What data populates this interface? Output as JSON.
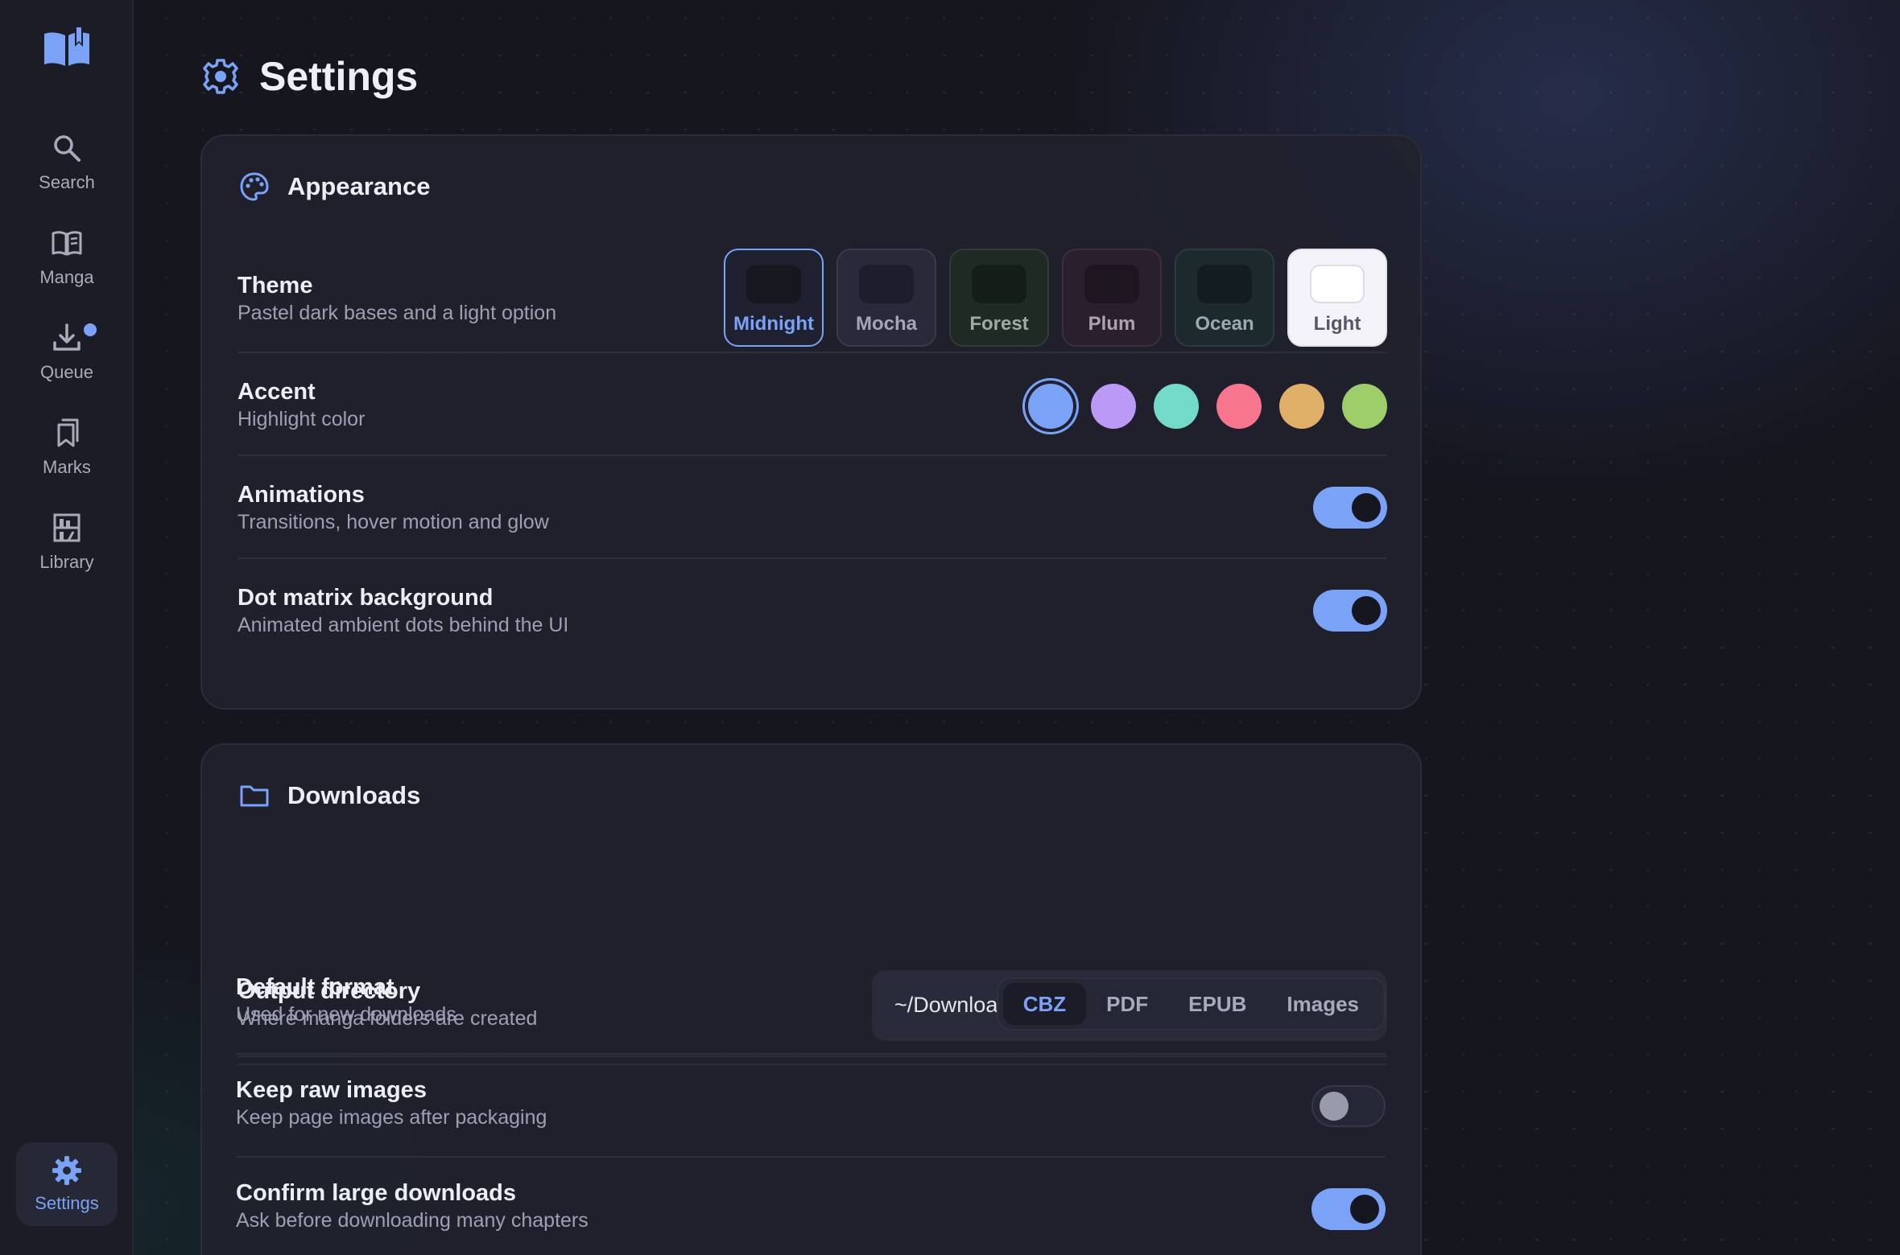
{
  "sidebar": {
    "items": [
      {
        "label": "Search",
        "icon": "search-icon"
      },
      {
        "label": "Manga",
        "icon": "book-open-icon"
      },
      {
        "label": "Queue",
        "icon": "download-icon",
        "badge": true
      },
      {
        "label": "Marks",
        "icon": "bookmarks-icon"
      },
      {
        "label": "Library",
        "icon": "bookshelf-icon"
      }
    ],
    "settings_label": "Settings"
  },
  "header": {
    "title": "Settings"
  },
  "appearance": {
    "title": "Appearance",
    "theme": {
      "title": "Theme",
      "sub": "Pastel dark bases and a light option",
      "options": [
        {
          "label": "Midnight",
          "bg": "#1f2030",
          "inner": "#16171f",
          "text": "#7aa2f7",
          "border": "#7aa2f7"
        },
        {
          "label": "Mocha",
          "bg": "#2a2939",
          "inner": "#1e1d2b",
          "text": "#a4a5b8",
          "border": "#3a3a4f"
        },
        {
          "label": "Forest",
          "bg": "#1f2a24",
          "inner": "#151d19",
          "text": "#9eaaa3",
          "border": "#2f3d34"
        },
        {
          "label": "Plum",
          "bg": "#2a1f2d",
          "inner": "#1d1520",
          "text": "#aea2b2",
          "border": "#3c2e40"
        },
        {
          "label": "Ocean",
          "bg": "#1c2a2e",
          "inner": "#131d21",
          "text": "#9aaaae",
          "border": "#2b3c41"
        },
        {
          "label": "Light",
          "bg": "#f4f4f8",
          "inner": "#ffffff",
          "text": "#55566a",
          "border": "#e2e2ea"
        }
      ],
      "selected": "Midnight"
    },
    "accent": {
      "title": "Accent",
      "sub": "Highlight color",
      "colors": [
        "#7aa2f7",
        "#bb9af7",
        "#73daca",
        "#f7768e",
        "#e0af68",
        "#9ece6a"
      ],
      "selected": "#7aa2f7"
    },
    "animations": {
      "title": "Animations",
      "sub": "Transitions, hover motion and glow",
      "on": true
    },
    "dot_matrix": {
      "title": "Dot matrix background",
      "sub": "Animated ambient dots behind the UI",
      "on": true
    }
  },
  "downloads": {
    "title": "Downloads",
    "output_dir": {
      "title": "Output directory",
      "sub": "Where manga folders are created",
      "value": "~/Downloads/WeebCentral"
    },
    "format": {
      "title": "Default format",
      "sub": "Used for new downloads",
      "options": [
        "CBZ",
        "PDF",
        "EPUB",
        "Images"
      ],
      "selected": "CBZ"
    },
    "keep_raw": {
      "title": "Keep raw images",
      "sub": "Keep page images after packaging",
      "on": false
    },
    "confirm_large": {
      "title": "Confirm large downloads",
      "sub": "Ask before downloading many chapters",
      "on": true
    }
  },
  "colors": {
    "accent": "#7aa2f7"
  }
}
